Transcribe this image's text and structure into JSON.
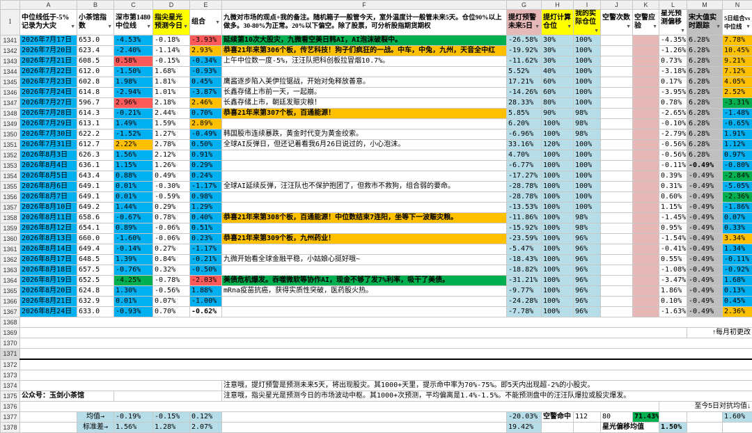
{
  "columns": [
    "",
    "A",
    "B",
    "C",
    "D",
    "E",
    "F",
    "G",
    "H",
    "I",
    "J",
    "K",
    "L",
    "M",
    "N"
  ],
  "header": {
    "row_number_1": "1",
    "A": "中位线低于-5%记录为大灾",
    "B": "小茶馆指数",
    "C": "深市第1480中位线",
    "D": "指尖星光预测今日",
    "E": "组合",
    "F": "九微对市场的观点+我的备注。随机箱子一般管今天，室外温度计一般管未来5天。仓位90%以上做多。30-80%为正常。20%以下偏空。除了股票，可分析股指期货期权",
    "G": "提灯预警未来5日",
    "H": "提灯计算仓位",
    "I": "我的实际仓位",
    "J": "空警次数",
    "K": "空警应验",
    "L": "星光预测偏移",
    "M": "宋大值实时跟踪",
    "N": "5日组合vs中位线"
  },
  "rows": [
    {
      "n": "1341",
      "A": "2026年7月17日",
      "B": "653.0",
      "C": "-4.53%",
      "D": "-0.18%",
      "E": "-3.93%",
      "F": "延续第10次大股灾，九微看空美日韩AI，AI泡沫破裂中。",
      "G": "-26.58%",
      "H": "30%",
      "I": "100%",
      "J": "",
      "K": "",
      "L": "-4.35%",
      "M": "6.28%",
      "N": "7.78%"
    },
    {
      "n": "1342",
      "A": "2026年7月20日",
      "B": "623.4",
      "C": "-2.40%",
      "D": "-1.14%",
      "E": "2.93%",
      "F": "恭喜21年来第306个板，传艺科技！狗子们疯狂的一战。中车，中兔，九州，天音全中红",
      "G": "-19.92%",
      "H": "30%",
      "I": "100%",
      "J": "",
      "K": "",
      "L": "-1.26%",
      "M": "6.28%",
      "N": "10.45%"
    },
    {
      "n": "1343",
      "A": "2026年7月21日",
      "B": "608.5",
      "C": "0.58%",
      "D": "-0.15%",
      "E": "-0.34%",
      "F": "上午中位数一度-5%，汪汪队把科创板拉冒烟10.7%。",
      "G": "-11.62%",
      "H": "30%",
      "I": "100%",
      "J": "",
      "K": "",
      "L": "0.73%",
      "M": "6.28%",
      "N": "9.21%"
    },
    {
      "n": "1344",
      "A": "2026年7月22日",
      "B": "612.0",
      "C": "-1.50%",
      "D": "1.68%",
      "E": "-0.93%",
      "F": "",
      "G": "5.52%",
      "H": "40%",
      "I": "100%",
      "J": "",
      "K": "",
      "L": "-3.18%",
      "M": "6.28%",
      "N": "7.12%"
    },
    {
      "n": "1345",
      "A": "2026年7月23日",
      "B": "602.8",
      "C": "1.98%",
      "D": "1.81%",
      "E": "0.45%",
      "F": "鹰酱逐步陷入美伊拉锯战，开始对兔释放善意。",
      "G": "17.21%",
      "H": "60%",
      "I": "100%",
      "J": "",
      "K": "",
      "L": "0.17%",
      "M": "6.28%",
      "N": "4.05%"
    },
    {
      "n": "1346",
      "A": "2026年7月24日",
      "B": "614.8",
      "C": "-2.94%",
      "D": "1.01%",
      "E": "-3.87%",
      "F": "长鑫存储上市前一天，一起崩。",
      "G": "-14.26%",
      "H": "60%",
      "I": "100%",
      "J": "",
      "K": "",
      "L": "-3.95%",
      "M": "6.28%",
      "N": "2.52%"
    },
    {
      "n": "1347",
      "A": "2026年7月27日",
      "B": "596.7",
      "C": "2.96%",
      "D": "2.18%",
      "E": "2.46%",
      "F": "长鑫存储上市，朝廷发赈灾粮！",
      "G": "28.33%",
      "H": "80%",
      "I": "100%",
      "J": "",
      "K": "",
      "L": "0.78%",
      "M": "6.28%",
      "N": "-3.31%"
    },
    {
      "n": "1348",
      "A": "2026年7月28日",
      "B": "614.3",
      "C": "-0.21%",
      "D": "2.44%",
      "E": "0.70%",
      "F": "恭喜21年来第307个板，百通能源！",
      "G": "5.85%",
      "H": "90%",
      "I": "98%",
      "J": "",
      "K": "",
      "L": "-2.65%",
      "M": "6.28%",
      "N": "-1.48%"
    },
    {
      "n": "1349",
      "A": "2026年7月29日",
      "B": "613.1",
      "C": "1.49%",
      "D": "1.59%",
      "E": "2.89%",
      "F": "",
      "G": "6.20%",
      "H": "100%",
      "I": "98%",
      "J": "",
      "K": "",
      "L": "-0.10%",
      "M": "6.28%",
      "N": "-0.65%"
    },
    {
      "n": "1350",
      "A": "2026年7月30日",
      "B": "622.2",
      "C": "-1.52%",
      "D": "1.27%",
      "E": "-0.49%",
      "F": "韩国股市连续暴跌，黄金时代变为黄金绞索。",
      "G": "-6.96%",
      "H": "100%",
      "I": "98%",
      "J": "",
      "K": "",
      "L": "-2.79%",
      "M": "6.28%",
      "N": "1.91%"
    },
    {
      "n": "1351",
      "A": "2026年7月31日",
      "B": "612.7",
      "C": "2.22%",
      "D": "2.78%",
      "E": "0.50%",
      "F": "全球AI反弹日，但还记着看我6月26日说过的，小心泡沫。",
      "G": "33.16%",
      "H": "120%",
      "I": "100%",
      "J": "",
      "K": "",
      "L": "-0.56%",
      "M": "6.28%",
      "N": "1.12%"
    },
    {
      "n": "1352",
      "A": "2026年8月3日",
      "B": "626.3",
      "C": "1.56%",
      "D": "2.12%",
      "E": "0.91%",
      "F": "",
      "G": "4.70%",
      "H": "100%",
      "I": "100%",
      "J": "",
      "K": "",
      "L": "-0.56%",
      "M": "6.28%",
      "N": "0.97%"
    },
    {
      "n": "1353",
      "A": "2026年8月4日",
      "B": "636.1",
      "C": "1.15%",
      "D": "1.26%",
      "E": "0.29%",
      "F": "",
      "G": "-6.77%",
      "H": "100%",
      "I": "100%",
      "J": "",
      "K": "",
      "L": "-0.11%",
      "M": "-0.49%",
      "N": "-0.80%"
    },
    {
      "n": "1354",
      "A": "2026年8月5日",
      "B": "643.4",
      "C": "0.88%",
      "D": "0.49%",
      "E": "0.24%",
      "F": "",
      "G": "-17.27%",
      "H": "100%",
      "I": "100%",
      "J": "",
      "K": "",
      "L": "0.39%",
      "M": "-0.49%",
      "N": "-2.84%"
    },
    {
      "n": "1355",
      "A": "2026年8月6日",
      "B": "649.1",
      "C": "0.01%",
      "D": "-0.30%",
      "E": "-1.17%",
      "F": "全球AI延续反弹，汪汪队也不保护抱团了，但救市不救狗，组合弱的要命。",
      "G": "-28.78%",
      "H": "100%",
      "I": "100%",
      "J": "",
      "K": "",
      "L": "0.31%",
      "M": "-0.49%",
      "N": "-5.05%"
    },
    {
      "n": "1356",
      "A": "2026年8月7日",
      "B": "649.1",
      "C": "0.01%",
      "D": "-0.59%",
      "E": "0.98%",
      "F": "",
      "G": "-28.78%",
      "H": "100%",
      "I": "100%",
      "J": "",
      "K": "",
      "L": "0.60%",
      "M": "-0.49%",
      "N": "-2.36%"
    },
    {
      "n": "1357",
      "A": "2026年8月10日",
      "B": "649.2",
      "C": "1.44%",
      "D": "0.29%",
      "E": "1.29%",
      "F": "",
      "G": "-13.53%",
      "H": "100%",
      "I": "100%",
      "J": "",
      "K": "",
      "L": "1.15%",
      "M": "-0.49%",
      "N": "-1.86%"
    },
    {
      "n": "1358",
      "A": "2026年8月11日",
      "B": "658.6",
      "C": "-0.67%",
      "D": "0.78%",
      "E": "0.40%",
      "F": "恭喜21年来第308个板，百通能源！中位数结束7连阳，坐等下一波赈灾粮。",
      "G": "-11.86%",
      "H": "100%",
      "I": "98%",
      "J": "",
      "K": "",
      "L": "-1.45%",
      "M": "-0.49%",
      "N": "0.07%"
    },
    {
      "n": "1359",
      "A": "2026年8月12日",
      "B": "654.1",
      "C": "0.89%",
      "D": "-0.06%",
      "E": "0.51%",
      "F": "",
      "G": "-15.92%",
      "H": "100%",
      "I": "98%",
      "J": "",
      "K": "",
      "L": "0.95%",
      "M": "-0.49%",
      "N": "0.33%"
    },
    {
      "n": "1360",
      "A": "2026年8月13日",
      "B": "660.0",
      "C": "-1.60%",
      "D": "-0.06%",
      "E": "0.23%",
      "F": "恭喜21年来第309个板，九州药业！",
      "G": "-23.59%",
      "H": "100%",
      "I": "96%",
      "J": "",
      "K": "",
      "L": "-1.54%",
      "M": "-0.49%",
      "N": "3.34%"
    },
    {
      "n": "1361",
      "A": "2026年8月14日",
      "B": "649.4",
      "C": "-0.14%",
      "D": "0.27%",
      "E": "-1.17%",
      "F": "",
      "G": "-5.47%",
      "H": "100%",
      "I": "96%",
      "J": "",
      "K": "",
      "L": "-0.41%",
      "M": "-0.49%",
      "N": "1.34%"
    },
    {
      "n": "1362",
      "A": "2026年8月17日",
      "B": "648.5",
      "C": "1.39%",
      "D": "0.84%",
      "E": "-0.21%",
      "F": "九微开始看全球金融平稳，小姑娘心挺好哦~",
      "G": "-18.43%",
      "H": "100%",
      "I": "96%",
      "J": "",
      "K": "",
      "L": "0.55%",
      "M": "-0.49%",
      "N": "-0.11%"
    },
    {
      "n": "1363",
      "A": "2026年8月18日",
      "B": "657.5",
      "C": "-0.76%",
      "D": "0.32%",
      "E": "-0.50%",
      "F": "",
      "G": "-18.82%",
      "H": "100%",
      "I": "96%",
      "J": "",
      "K": "",
      "L": "-1.08%",
      "M": "-0.49%",
      "N": "-0.92%"
    },
    {
      "n": "1364",
      "A": "2026年8月19日",
      "B": "652.5",
      "C": "-4.25%",
      "D": "-0.78%",
      "E": "-2.03%",
      "F": "美债危机爆发。吞噬微软等协作AI，现金不够了发7%利率，吸干了美债。",
      "G": "-31.21%",
      "H": "100%",
      "I": "96%",
      "J": "",
      "K": "",
      "L": "-3.47%",
      "M": "-0.49%",
      "N": "1.68%"
    },
    {
      "n": "1365",
      "A": "2026年8月20日",
      "B": "624.8",
      "C": "1.30%",
      "D": "-0.56%",
      "E": "1.88%",
      "F": "mRna疫苗抗癌，获得实质性突破，医药股火热。",
      "G": "-9.77%",
      "H": "100%",
      "I": "96%",
      "J": "",
      "K": "",
      "L": "1.86%",
      "M": "-0.49%",
      "N": "0.13%"
    },
    {
      "n": "1366",
      "A": "2026年8月21日",
      "B": "632.9",
      "C": "0.01%",
      "D": "0.07%",
      "E": "-1.00%",
      "F": "",
      "G": "-24.28%",
      "H": "100%",
      "I": "96%",
      "J": "",
      "K": "",
      "L": "0.10%",
      "M": "-0.49%",
      "N": "0.45%"
    },
    {
      "n": "1367",
      "A": "2026年8月24日",
      "B": "633.0",
      "C": "-0.93%",
      "D": "0.70%",
      "E": "-0.62%",
      "F": "",
      "G": "-7.78%",
      "H": "100%",
      "I": "96%",
      "J": "",
      "K": "",
      "L": "-1.63%",
      "M": "-0.49%",
      "N": "2.36%"
    }
  ],
  "footer": {
    "r1368": "1368",
    "r1369": "1369",
    "r1369_text": "↑每月初更改",
    "r1370": "1370",
    "r1371": "1371",
    "r1372": "1372",
    "r1373": "1373",
    "r1374": "1374",
    "r1374_text": "注意哦，提灯预警是预测未来5天，将出现股灾。其1000+天里，提示命中率为70%-75%。即5天内出现超-2%的小股灾。",
    "r1375": "1375",
    "r1375_a": "公众号：玉剑小茶馆",
    "r1375_text": "注意哦，指尖星光是预测今日的市场波动中枢。其1000+次预测，平均偏离是1.4%-1.5%。不能预测盘中的汪汪队爆拉或股灾爆发。",
    "r1376": "1376",
    "r1376_text": "至今5日对抗均值↓",
    "r1377": "1377",
    "r1377_a": "均值→",
    "r1377_c": "-0.19%",
    "r1377_d": "-0.15%",
    "r1377_e": "0.12%",
    "r1377_g": "-20.03%",
    "r1377_h": "空警命中",
    "r1377_h2": "112",
    "r1377_i": "80",
    "r1377_k": "71.43%",
    "r1377_n": "1.60%",
    "r1378": "1378",
    "r1378_a": "标准差→",
    "r1378_c": "1.56%",
    "r1378_d": "1.28%",
    "r1378_e": "2.07%",
    "r1378_g": "19.42%",
    "r1378_j": "星光偏移均值",
    "r1378_l": "1.50%"
  }
}
